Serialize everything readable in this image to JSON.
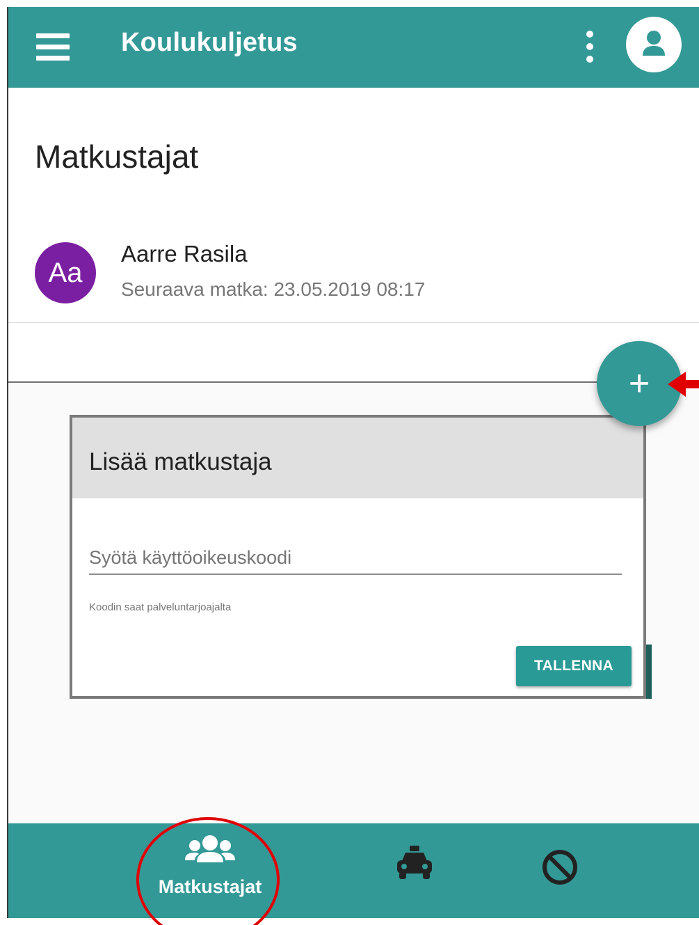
{
  "app_bar": {
    "title": "Koulukuljetus",
    "menu_icon": "hamburger-menu-icon",
    "more_icon": "more-vertical-icon",
    "account_icon": "account-circle-icon",
    "background_color": "#339996"
  },
  "page": {
    "title": "Matkustajat"
  },
  "passengers": [
    {
      "initials": "Aa",
      "name": "Aarre Rasila",
      "next_trip": "Seuraava matka: 23.05.2019 08:17",
      "avatar_color": "#7b1fa2"
    }
  ],
  "fab": {
    "icon": "plus-icon",
    "label": "+"
  },
  "dialog": {
    "title": "Lisää matkustaja",
    "input_placeholder": "Syötä käyttöoikeuskoodi",
    "input_value": "",
    "hint": "Koodin saat palveluntarjoajalta",
    "save_label": "TALLENNA"
  },
  "bottom_nav": {
    "items": [
      {
        "label": "Matkustajat",
        "icon": "users-icon",
        "active": true
      },
      {
        "label": "",
        "icon": "taxi-icon",
        "active": false
      },
      {
        "label": "",
        "icon": "block-icon",
        "active": false
      }
    ]
  },
  "annotations": {
    "highlight_color": "#e00000"
  }
}
